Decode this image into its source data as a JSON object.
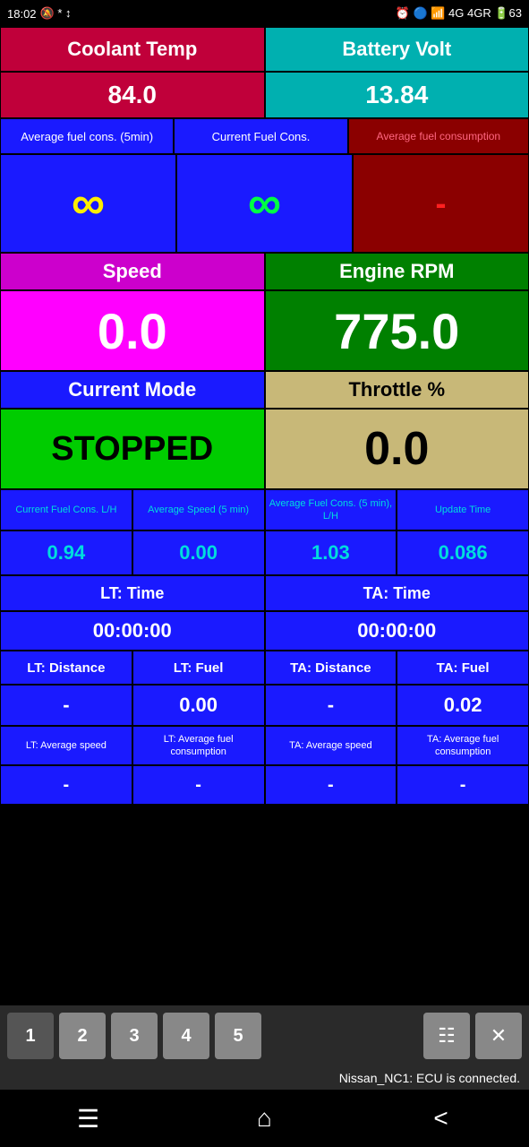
{
  "statusBar": {
    "time": "18:02",
    "batteryLevel": "63"
  },
  "coolant": {
    "label": "Coolant Temp",
    "value": "84.0"
  },
  "battery": {
    "label": "Battery Volt",
    "value": "13.84"
  },
  "avgFuelLabel": "Average fuel cons. (5min)",
  "currFuelLabel": "Current Fuel Cons.",
  "avgFuelRightLabel": "Average fuel consumption",
  "infinitySymbol": "∞",
  "dashSymbol": "-",
  "speed": {
    "label": "Speed",
    "value": "0.0"
  },
  "rpm": {
    "label": "Engine RPM",
    "value": "775.0"
  },
  "currentMode": {
    "label": "Current Mode",
    "value": "STOPPED"
  },
  "throttle": {
    "label": "Throttle %",
    "value": "0.0"
  },
  "stats": {
    "col1": {
      "label": "Current Fuel Cons. L/H",
      "value": "0.94"
    },
    "col2": {
      "label": "Average Speed (5 min)",
      "value": "0.00"
    },
    "col3": {
      "label": "Average Fuel Cons. (5 min), L/H",
      "value": "1.03"
    },
    "col4": {
      "label": "Update Time",
      "value": "0.086"
    }
  },
  "ltTime": {
    "label": "LT: Time",
    "value": "00:00:00"
  },
  "taTime": {
    "label": "TA: Time",
    "value": "00:00:00"
  },
  "ltDistance": {
    "label": "LT: Distance",
    "value": "-"
  },
  "ltFuel": {
    "label": "LT: Fuel",
    "value": "0.00"
  },
  "taDistance": {
    "label": "TA: Distance",
    "value": "-"
  },
  "taFuel": {
    "label": "TA: Fuel",
    "value": "0.02"
  },
  "ltAvgSpeed": {
    "label": "LT: Average speed",
    "value": "-"
  },
  "ltAvgFuel": {
    "label": "LT: Average fuel consumption",
    "value": "-"
  },
  "taAvgSpeed": {
    "label": "TA: Average speed",
    "value": "-"
  },
  "taAvgFuel": {
    "label": "TA: Average fuel consumption",
    "value": "-"
  },
  "tabs": {
    "active": "1",
    "labels": [
      "1",
      "2",
      "3",
      "4",
      "5"
    ]
  },
  "statusMsg": "Nissan_NC1: ECU is connected.",
  "nav": {
    "menu": "☰",
    "home": "⌂",
    "back": "<"
  }
}
